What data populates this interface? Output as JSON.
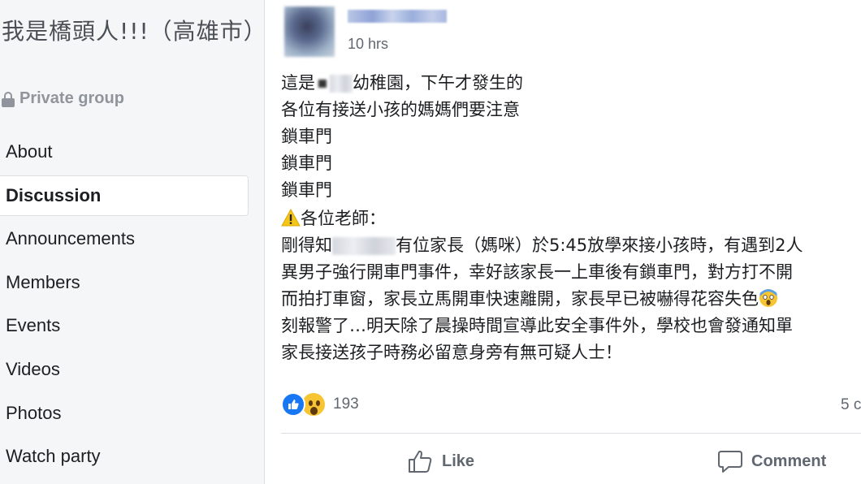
{
  "group": {
    "title": "我是橋頭人!!!（高雄市）",
    "privacy": "Private group"
  },
  "sidebar": {
    "items": [
      {
        "label": "About",
        "active": false
      },
      {
        "label": "Discussion",
        "active": true
      },
      {
        "label": "Announcements",
        "active": false
      },
      {
        "label": "Members",
        "active": false
      },
      {
        "label": "Events",
        "active": false
      },
      {
        "label": "Videos",
        "active": false
      },
      {
        "label": "Photos",
        "active": false
      },
      {
        "label": "Watch party",
        "active": false
      }
    ]
  },
  "post": {
    "timestamp": "10 hrs",
    "lines": {
      "l1_a": "這是",
      "l1_b": "幼稚園，下午才發生的",
      "l2": "各位有接送小孩的媽媽們要注意",
      "l3": "鎖車門",
      "l4": "鎖車門",
      "l5": "鎖車門",
      "l6": "各位老師：",
      "l7_a": "剛得知",
      "l7_b": "有位家長（媽咪）於5:45放學來接小孩時，有遇到2人",
      "l8": "異男子強行開車門事件，幸好該家長一上車後有鎖車門，對方打不開",
      "l9_a": "而拍打車窗，家長立馬開車快速離開，家長早已被嚇得花容失色",
      "l10": "刻報警了…明天除了晨操時間宣導此安全事件外，學校也會發通知單",
      "l11": "家長接送孩子時務必留意身旁有無可疑人士！"
    },
    "reactions_count": "193",
    "comments_count": "5 c",
    "like_label": "Like",
    "comment_label": "Comment"
  },
  "colors": {
    "sidebar_bg": "#f5f6f7",
    "page_bg": "#e9ebee",
    "text_secondary": "#606770",
    "like_blue": "#1877f2",
    "wow_yellow": "#f7c533"
  },
  "icons": [
    "lock-icon",
    "warning-icon",
    "scream-emoji-icon",
    "like-reaction-icon",
    "wow-reaction-icon",
    "thumbs-up-icon",
    "comment-bubble-icon"
  ]
}
